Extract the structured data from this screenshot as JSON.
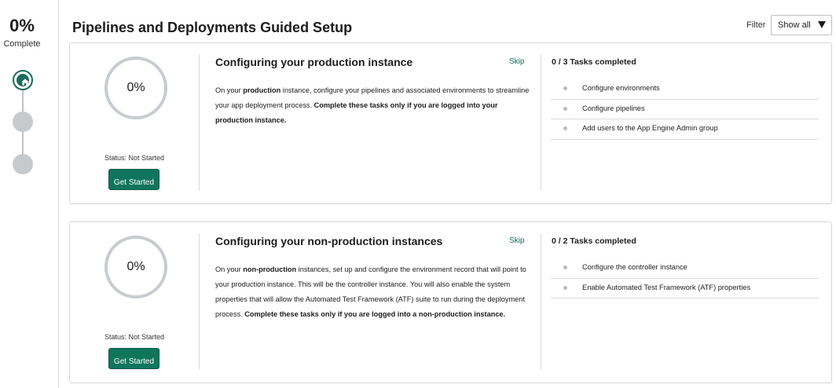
{
  "progress": {
    "percent": "0%",
    "label": "Complete"
  },
  "page": {
    "title": "Pipelines and Deployments Guided Setup"
  },
  "filter": {
    "label": "Filter",
    "value": "Show all"
  },
  "steps": [
    "home-icon",
    "step-pending",
    "step-pending"
  ],
  "colors": {
    "accent": "#10755d",
    "ring": "#c8ccd0",
    "divider": "#dcdcdc"
  },
  "cards": [
    {
      "percent": "0%",
      "status": "Status: Not Started",
      "button": "Get Started",
      "title": "Configuring your production instance",
      "skip": "Skip",
      "description": [
        {
          "t": "On your ",
          "b": false
        },
        {
          "t": "production",
          "b": true
        },
        {
          "t": " instance, configure your pipelines and associated environments to streamline your app deployment process. ",
          "b": false
        },
        {
          "t": "Complete these tasks only if you are logged into your production instance.",
          "b": true
        }
      ],
      "tasks_title": "0 / 3 Tasks completed",
      "tasks": [
        "Configure environments",
        "Configure pipelines",
        "Add users to the App Engine Admin group"
      ]
    },
    {
      "percent": "0%",
      "status": "Status: Not Started",
      "button": "Get Started",
      "title": "Configuring your non-production instances",
      "skip": "Skip",
      "description": [
        {
          "t": "On your ",
          "b": false
        },
        {
          "t": "non-production",
          "b": true
        },
        {
          "t": " instances, set up and configure the environment record that will point to your production instance. This will be the controller instance. You will also enable the system properties that will allow the Automated Test Framework (ATF) suite to run during the deployment process. ",
          "b": false
        },
        {
          "t": "Complete these tasks only if you are logged into a non-production instance.",
          "b": true
        }
      ],
      "tasks_title": "0 / 2 Tasks completed",
      "tasks": [
        "Configure the controller instance",
        "Enable Automated Test Framework (ATF) properties"
      ]
    }
  ]
}
